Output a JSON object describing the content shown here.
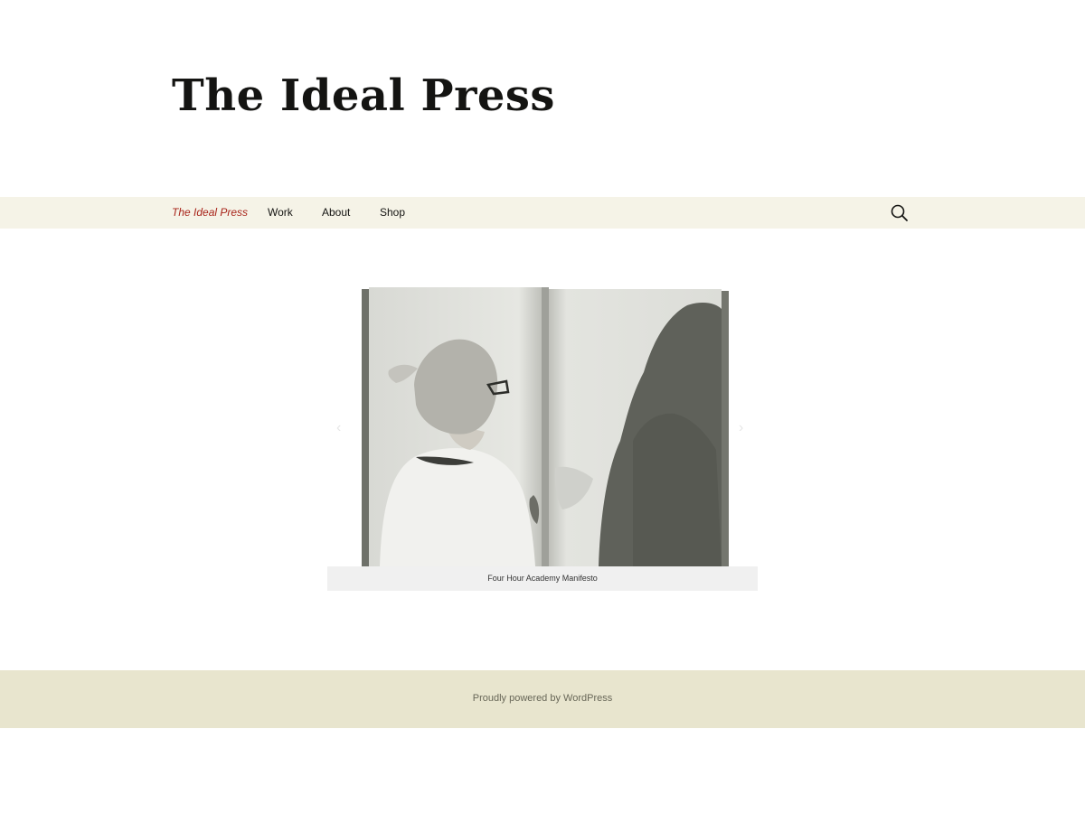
{
  "site": {
    "title": "The Ideal Press"
  },
  "nav": {
    "items": [
      {
        "label": "The Ideal Press",
        "current": true
      },
      {
        "label": "Work"
      },
      {
        "label": "About"
      },
      {
        "label": "Shop"
      }
    ],
    "search_icon": "search-icon"
  },
  "gallery": {
    "caption": "Four Hour Academy Manifesto",
    "prev_icon": "chevron-left-icon",
    "next_icon": "chevron-right-icon",
    "prev_glyph": "‹",
    "next_glyph": "›"
  },
  "footer": {
    "credit": "Proudly powered by WordPress"
  },
  "colors": {
    "nav_background": "#f5f3e7",
    "nav_current": "#a8241a",
    "footer_background": "#e8e5ce",
    "caption_background": "#f0f0f0"
  }
}
